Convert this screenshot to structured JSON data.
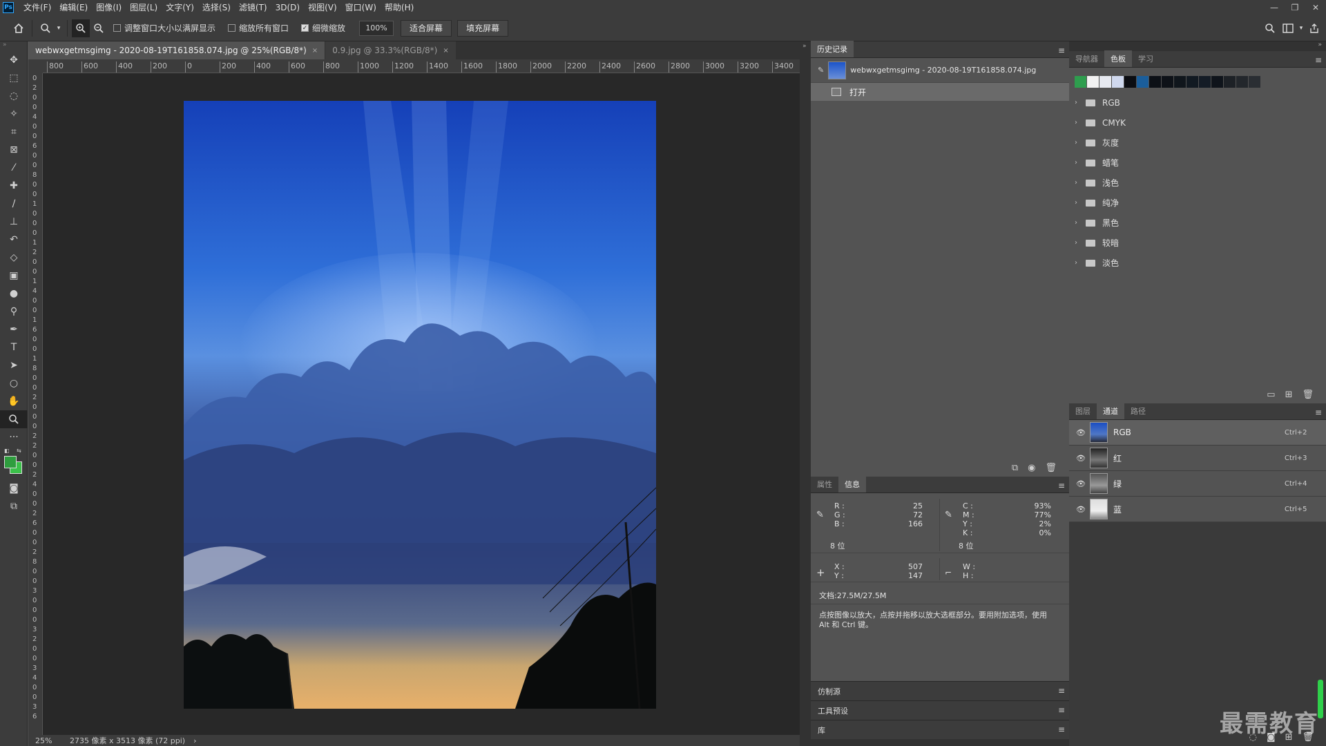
{
  "menubar": {
    "logo": "Ps",
    "items": [
      "文件(F)",
      "编辑(E)",
      "图像(I)",
      "图层(L)",
      "文字(Y)",
      "选择(S)",
      "滤镜(T)",
      "3D(D)",
      "视图(V)",
      "窗口(W)",
      "帮助(H)"
    ],
    "window_controls": {
      "minimize": "—",
      "restore": "❐",
      "close": "✕"
    }
  },
  "options": {
    "resize_windows_label": "调整窗口大小以满屏显示",
    "resize_windows_checked": false,
    "zoom_all_label": "缩放所有窗口",
    "zoom_all_checked": false,
    "scrubby_label": "细微缩放",
    "scrubby_checked": true,
    "zoom_value": "100%",
    "fit_screen_label": "适合屏幕",
    "fill_screen_label": "填充屏幕"
  },
  "documents": {
    "tabs": [
      {
        "label": "webwxgetmsgimg - 2020-08-19T161858.074.jpg @ 25%(RGB/8*)",
        "active": true
      },
      {
        "label": "0.9.jpg @ 33.3%(RGB/8*)",
        "active": false
      }
    ],
    "close_glyph": "×"
  },
  "ruler": {
    "h_labels": [
      "800",
      "600",
      "400",
      "200",
      "0",
      "200",
      "400",
      "600",
      "800",
      "1000",
      "1200",
      "1400",
      "1600",
      "1800",
      "2000",
      "2200",
      "2400",
      "2600",
      "2800",
      "3000",
      "3200",
      "3400"
    ],
    "v_labels": [
      "0",
      "2",
      "0",
      "0",
      "4",
      "0",
      "0",
      "6",
      "0",
      "0",
      "8",
      "0",
      "0",
      "1",
      "0",
      "0",
      "0",
      "1",
      "2",
      "0",
      "0",
      "1",
      "4",
      "0",
      "0",
      "1",
      "6",
      "0",
      "0",
      "1",
      "8",
      "0",
      "0",
      "2",
      "0",
      "0",
      "0",
      "2",
      "2",
      "0",
      "0",
      "2",
      "4",
      "0",
      "0",
      "2",
      "6",
      "0",
      "0",
      "2",
      "8",
      "0",
      "0",
      "3",
      "0",
      "0",
      "0",
      "3",
      "2",
      "0",
      "0",
      "3",
      "4",
      "0",
      "0",
      "3",
      "6"
    ]
  },
  "status": {
    "zoom": "25%",
    "info": "2735 像素 x 3513 像素 (72 ppi)",
    "arrow": "›"
  },
  "history": {
    "tab_label": "历史记录",
    "snapshot_name": "webwxgetmsgimg - 2020-08-19T161858.074.jpg",
    "steps": [
      "打开"
    ]
  },
  "info_panel": {
    "tabs": [
      "属性",
      "信息"
    ],
    "rgb": {
      "r_label": "R :",
      "r": "25",
      "g_label": "G :",
      "g": "72",
      "b_label": "B :",
      "b": "166"
    },
    "cmyk": {
      "c_label": "C :",
      "c": "93%",
      "m_label": "M :",
      "m": "77%",
      "y_label": "Y :",
      "y": "2%",
      "k_label": "K :",
      "k": "0%"
    },
    "bits_left": "8 位",
    "bits_right": "8 位",
    "xy": {
      "x_label": "X :",
      "x": "507",
      "y_label": "Y :",
      "y": "147"
    },
    "wh": {
      "w_label": "W :",
      "h_label": "H :"
    },
    "doc_size": "文档:27.5M/27.5M",
    "hint": "点按图像以放大，点按并拖移以放大选框部分。要用附加选项，使用 Alt 和 Ctrl 键。"
  },
  "stacked_panels": [
    "仿制源",
    "工具预设",
    "库"
  ],
  "swatches_panel": {
    "tabs": [
      "导航器",
      "色板",
      "学习"
    ],
    "colors": [
      "#2e9d4e",
      "#f2f2f2",
      "#e6e9f0",
      "#cfd8ee",
      "#0b0d12",
      "#1b5e9b",
      "#0c1016",
      "#0e1218",
      "#10161c",
      "#121a22",
      "#141c26",
      "#0f141b",
      "#1d2126",
      "#23272c",
      "#2a2e33"
    ],
    "groups": [
      "RGB",
      "CMYK",
      "灰度",
      "蜡笔",
      "浅色",
      "纯净",
      "黑色",
      "较暗",
      "淡色"
    ]
  },
  "channels_panel": {
    "tabs": [
      "图层",
      "通道",
      "路径"
    ],
    "channels": [
      {
        "name": "RGB",
        "shortcut": "Ctrl+2"
      },
      {
        "name": "红",
        "shortcut": "Ctrl+3"
      },
      {
        "name": "绿",
        "shortcut": "Ctrl+4"
      },
      {
        "name": "蓝",
        "shortcut": "Ctrl+5"
      }
    ]
  },
  "watermark": "最需教育"
}
